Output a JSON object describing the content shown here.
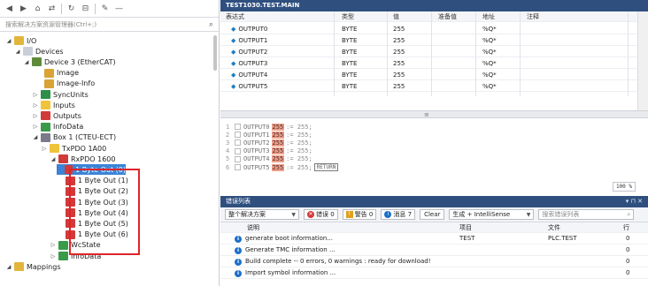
{
  "colors": {
    "accent": "#2f4f7f",
    "selection": "#3b84d8",
    "highlight_box": "#e0242a",
    "online_value": "#f0a08a",
    "info": "#1c6fc9"
  },
  "explorer": {
    "search_placeholder": "搜索解决方案资源管理器(Ctrl+;)",
    "tree": [
      {
        "label": "I/O",
        "toggle": "◢",
        "icon_color": "#e2b63a"
      },
      {
        "label": "Devices",
        "toggle": "◢",
        "icon_color": "#c9cfd8"
      },
      {
        "label": "Device 3 (EtherCAT)",
        "toggle": "◢",
        "icon_color": "#5f8a3a"
      },
      {
        "label": "Image",
        "toggle": "",
        "icon_color": "#d9a336"
      },
      {
        "label": "Image-Info",
        "toggle": "",
        "icon_color": "#d9a336"
      },
      {
        "label": "SyncUnits",
        "toggle": "▷",
        "icon_color": "#2f8f4a"
      },
      {
        "label": "Inputs",
        "toggle": "▷",
        "icon_color": "#f0c43a"
      },
      {
        "label": "Outputs",
        "toggle": "▷",
        "icon_color": "#d23a3a"
      },
      {
        "label": "InfoData",
        "toggle": "▷",
        "icon_color": "#3a9a4a"
      },
      {
        "label": "Box 1 (CTEU-ECT)",
        "toggle": "◢",
        "icon_color": "#7a7a8a"
      },
      {
        "label": "TxPDO 1A00",
        "toggle": "▷",
        "icon_color": "#f0c43a"
      },
      {
        "label": "RxPDO 1600",
        "toggle": "◢",
        "icon_color": "#d23a3a"
      },
      {
        "label": "1 Byte Out (0)",
        "toggle": "",
        "icon_color": "#d23a3a",
        "selected": true
      },
      {
        "label": "1 Byte Out (1)",
        "toggle": "",
        "icon_color": "#d23a3a"
      },
      {
        "label": "1 Byte Out (2)",
        "toggle": "",
        "icon_color": "#d23a3a"
      },
      {
        "label": "1 Byte Out (3)",
        "toggle": "",
        "icon_color": "#d23a3a"
      },
      {
        "label": "1 Byte Out (4)",
        "toggle": "",
        "icon_color": "#d23a3a"
      },
      {
        "label": "1 Byte Out (5)",
        "toggle": "",
        "icon_color": "#d23a3a"
      },
      {
        "label": "1 Byte Out (6)",
        "toggle": "",
        "icon_color": "#d23a3a"
      },
      {
        "label": "WcState",
        "toggle": "▷",
        "icon_color": "#3a9a4a"
      },
      {
        "label": "InfoData",
        "toggle": "▷",
        "icon_color": "#3a9a4a"
      },
      {
        "label": "Mappings",
        "toggle": "◢",
        "icon_color": "#e2b63a"
      }
    ]
  },
  "editor": {
    "title": "TEST1030.TEST.MAIN",
    "columns": [
      "表达式",
      "类型",
      "值",
      "准备值",
      "地址",
      "注释"
    ],
    "rows": [
      {
        "name": "OUTPUT0",
        "type": "BYTE",
        "value": "255",
        "prepared": "",
        "address": "%Q*",
        "comment": ""
      },
      {
        "name": "OUTPUT1",
        "type": "BYTE",
        "value": "255",
        "prepared": "",
        "address": "%Q*",
        "comment": ""
      },
      {
        "name": "OUTPUT2",
        "type": "BYTE",
        "value": "255",
        "prepared": "",
        "address": "%Q*",
        "comment": ""
      },
      {
        "name": "OUTPUT3",
        "type": "BYTE",
        "value": "255",
        "prepared": "",
        "address": "%Q*",
        "comment": ""
      },
      {
        "name": "OUTPUT4",
        "type": "BYTE",
        "value": "255",
        "prepared": "",
        "address": "%Q*",
        "comment": ""
      },
      {
        "name": "OUTPUT5",
        "type": "BYTE",
        "value": "255",
        "prepared": "",
        "address": "%Q*",
        "comment": ""
      }
    ],
    "code_lines": [
      {
        "n": "1",
        "var": "OUTPUT0",
        "val": "255",
        "rhs": ":= 255;",
        "tag": ""
      },
      {
        "n": "2",
        "var": "OUTPUT1",
        "val": "255",
        "rhs": ":= 255;",
        "tag": ""
      },
      {
        "n": "3",
        "var": "OUTPUT2",
        "val": "255",
        "rhs": ":= 255;",
        "tag": ""
      },
      {
        "n": "4",
        "var": "OUTPUT3",
        "val": "255",
        "rhs": ":= 255;",
        "tag": ""
      },
      {
        "n": "5",
        "var": "OUTPUT4",
        "val": "255",
        "rhs": ":= 255;",
        "tag": ""
      },
      {
        "n": "6",
        "var": "OUTPUT5",
        "val": "255",
        "rhs": ":= 255;",
        "tag": "RETURN"
      }
    ],
    "zoom": "100 %"
  },
  "error_list": {
    "title": "错误列表",
    "scope": "整个解决方案",
    "errors_label": "错误 0",
    "warnings_label": "警告 0",
    "messages_label": "消息 7",
    "clear_label": "Clear",
    "build_filter": "生成 + IntelliSense",
    "search_placeholder": "搜索错误列表",
    "columns": [
      "说明",
      "项目",
      "文件",
      "行"
    ],
    "rows": [
      {
        "desc": "generate boot information...",
        "project": "TEST",
        "file": "PLC.TEST",
        "line": "0"
      },
      {
        "desc": "Generate TMC information ...",
        "project": "",
        "file": "",
        "line": "0"
      },
      {
        "desc": "Build complete -- 0 errors, 0 warnings : ready for download!",
        "project": "",
        "file": "",
        "line": "0"
      },
      {
        "desc": "Import symbol information ...",
        "project": "",
        "file": "",
        "line": "0"
      }
    ]
  }
}
